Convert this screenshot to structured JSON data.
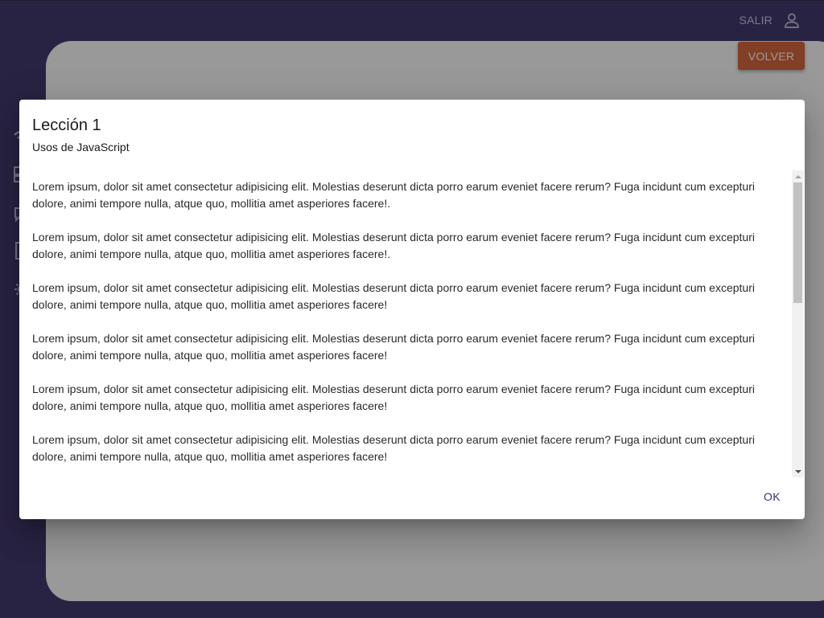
{
  "header": {
    "logout_label": "SALIR",
    "logout_icon": "person-outline-icon"
  },
  "sidebar": {
    "icons": [
      "wifi-icon",
      "dashboard-icon",
      "chat-icon",
      "document-icon",
      "settings-icon"
    ]
  },
  "content": {
    "back_label": "VOLVER"
  },
  "dialog": {
    "title": "Lección 1",
    "subtitle": "Usos de JavaScript",
    "paragraphs": [
      "Lorem ipsum, dolor sit amet consectetur adipisicing elit. Molestias deserunt dicta porro earum eveniet facere rerum? Fuga incidunt cum excepturi dolore, animi tempore nulla, atque quo, mollitia amet asperiores facere!.",
      "Lorem ipsum, dolor sit amet consectetur adipisicing elit. Molestias deserunt dicta porro earum eveniet facere rerum? Fuga incidunt cum excepturi dolore, animi tempore nulla, atque quo, mollitia amet asperiores facere!.",
      "Lorem ipsum, dolor sit amet consectetur adipisicing elit. Molestias deserunt dicta porro earum eveniet facere rerum? Fuga incidunt cum excepturi dolore, animi tempore nulla, atque quo, mollitia amet asperiores facere!",
      "Lorem ipsum, dolor sit amet consectetur adipisicing elit. Molestias deserunt dicta porro earum eveniet facere rerum? Fuga incidunt cum excepturi dolore, animi tempore nulla, atque quo, mollitia amet asperiores facere!",
      "Lorem ipsum, dolor sit amet consectetur adipisicing elit. Molestias deserunt dicta porro earum eveniet facere rerum? Fuga incidunt cum excepturi dolore, animi tempore nulla, atque quo, mollitia amet asperiores facere!",
      "Lorem ipsum, dolor sit amet consectetur adipisicing elit. Molestias deserunt dicta porro earum eveniet facere rerum? Fuga incidunt cum excepturi dolore, animi tempore nulla, atque quo, mollitia amet asperiores facere!"
    ],
    "ok_label": "OK"
  },
  "colors": {
    "primary": "#302560",
    "accent": "#d65a2c",
    "dialog_action": "#3c2f7c"
  }
}
